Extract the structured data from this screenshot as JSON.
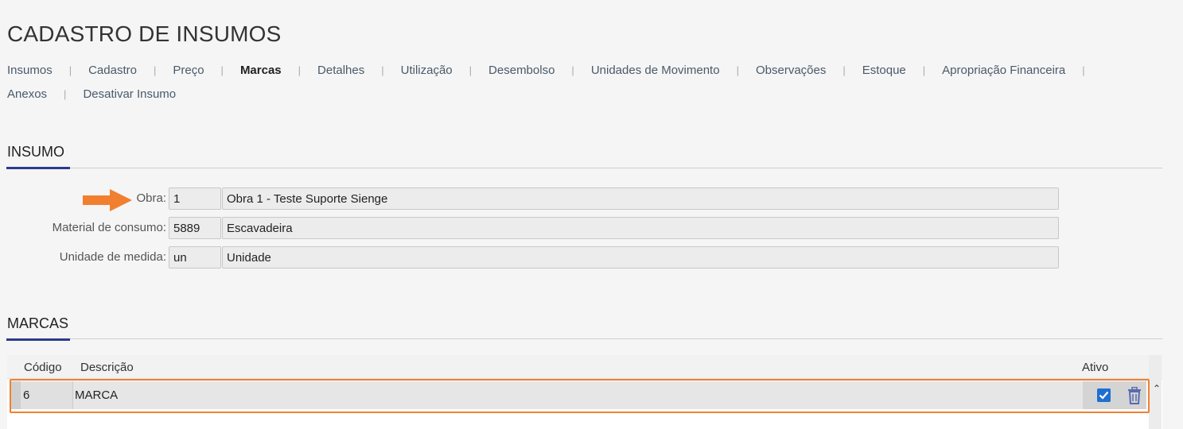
{
  "page": {
    "title": "CADASTRO DE INSUMOS"
  },
  "tabs": {
    "row1": [
      "Insumos",
      "Cadastro",
      "Preço",
      "Marcas",
      "Detalhes",
      "Utilização",
      "Desembolso",
      "Unidades de Movimento",
      "Observações",
      "Estoque",
      "Apropriação Financeira"
    ],
    "row2": [
      "Anexos",
      "Desativar Insumo"
    ],
    "active": "Marcas"
  },
  "insumo": {
    "section_title": "INSUMO",
    "fields": [
      {
        "label": "Obra:",
        "code": "1",
        "description": "Obra 1 - Teste Suporte Sienge"
      },
      {
        "label": "Material de consumo:",
        "code": "5889",
        "description": "Escavadeira"
      },
      {
        "label": "Unidade de medida:",
        "code": "un",
        "description": "Unidade"
      }
    ]
  },
  "marcas": {
    "section_title": "MARCAS",
    "columns": {
      "codigo": "Código",
      "descricao": "Descrição",
      "ativo": "Ativo"
    },
    "rows": [
      {
        "codigo": "6",
        "descricao": "MARCA",
        "ativo": true
      }
    ]
  },
  "icons": {
    "arrow": "arrow-right-icon",
    "checkbox": "checkbox-checked-icon",
    "delete": "trash-icon",
    "scroll": "caret-up-icon"
  },
  "colors": {
    "accent": "#2d3a8c",
    "highlight": "#f08030",
    "arrow": "#f08030",
    "checkbox": "#1f6fd1",
    "trash": "#5a6ab0"
  }
}
